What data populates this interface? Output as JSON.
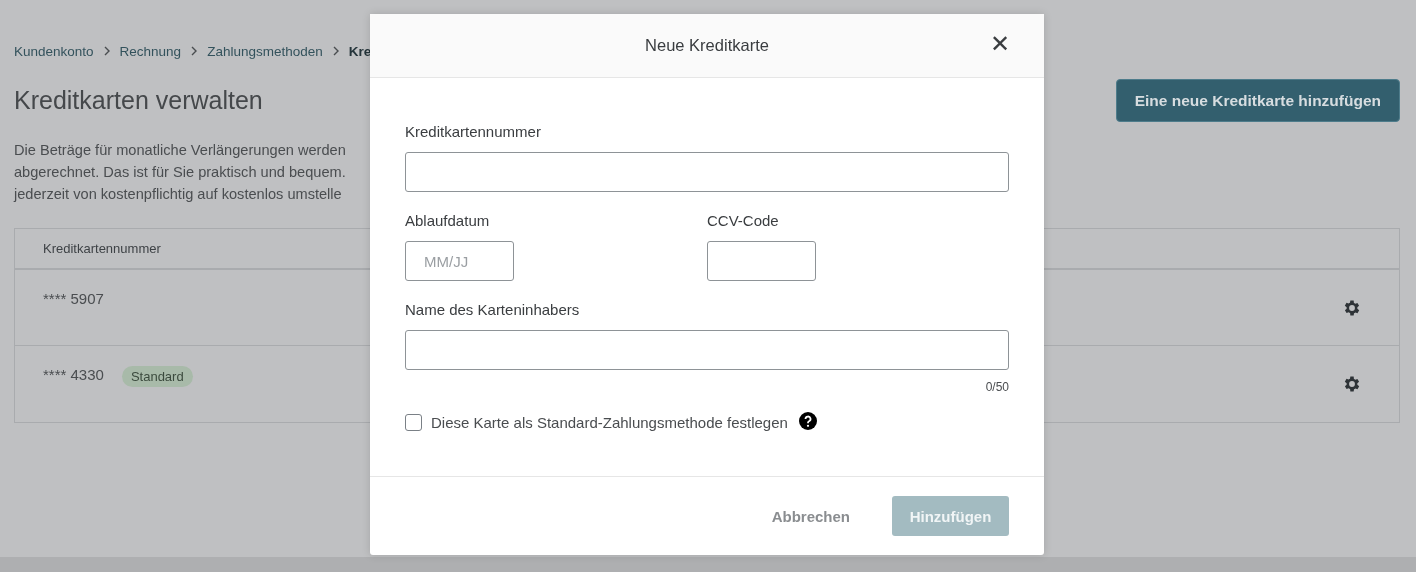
{
  "breadcrumb": [
    {
      "label": "Kundenkonto"
    },
    {
      "label": "Rechnung"
    },
    {
      "label": "Zahlungsmethoden"
    },
    {
      "label": "Kre"
    }
  ],
  "page_title": "Kreditkarten verwalten",
  "add_button": "Eine neue Kreditkarte hinzufügen",
  "description_lines": [
    "Die Beträge für monatliche Verlängerungen werden",
    "abgerechnet. Das ist für Sie praktisch und bequem.",
    "jederzeit von kostenpflichtig auf kostenlos umstelle"
  ],
  "table": {
    "columns": [
      "Kreditkartennummer"
    ],
    "rows": [
      {
        "number": "**** 5907"
      },
      {
        "number": "**** 4330",
        "badge": "Standard"
      }
    ]
  },
  "dialog": {
    "title": "Neue Kreditkarte",
    "close": "✕",
    "card_number": {
      "label": "Kreditkartennummer"
    },
    "expiry": {
      "label": "Ablaufdatum",
      "placeholder": "MM/JJ"
    },
    "ccv": {
      "label": "CCV-Code"
    },
    "holder": {
      "label": "Name des Karteninhabers",
      "counter": "0/50"
    },
    "default_checkbox": {
      "label": "Diese Karte als Standard-Zahlungsmethode festlegen",
      "checked": false
    },
    "cancel": "Abbrechen",
    "submit": {
      "label": "Hinzufügen",
      "disabled": true
    }
  }
}
